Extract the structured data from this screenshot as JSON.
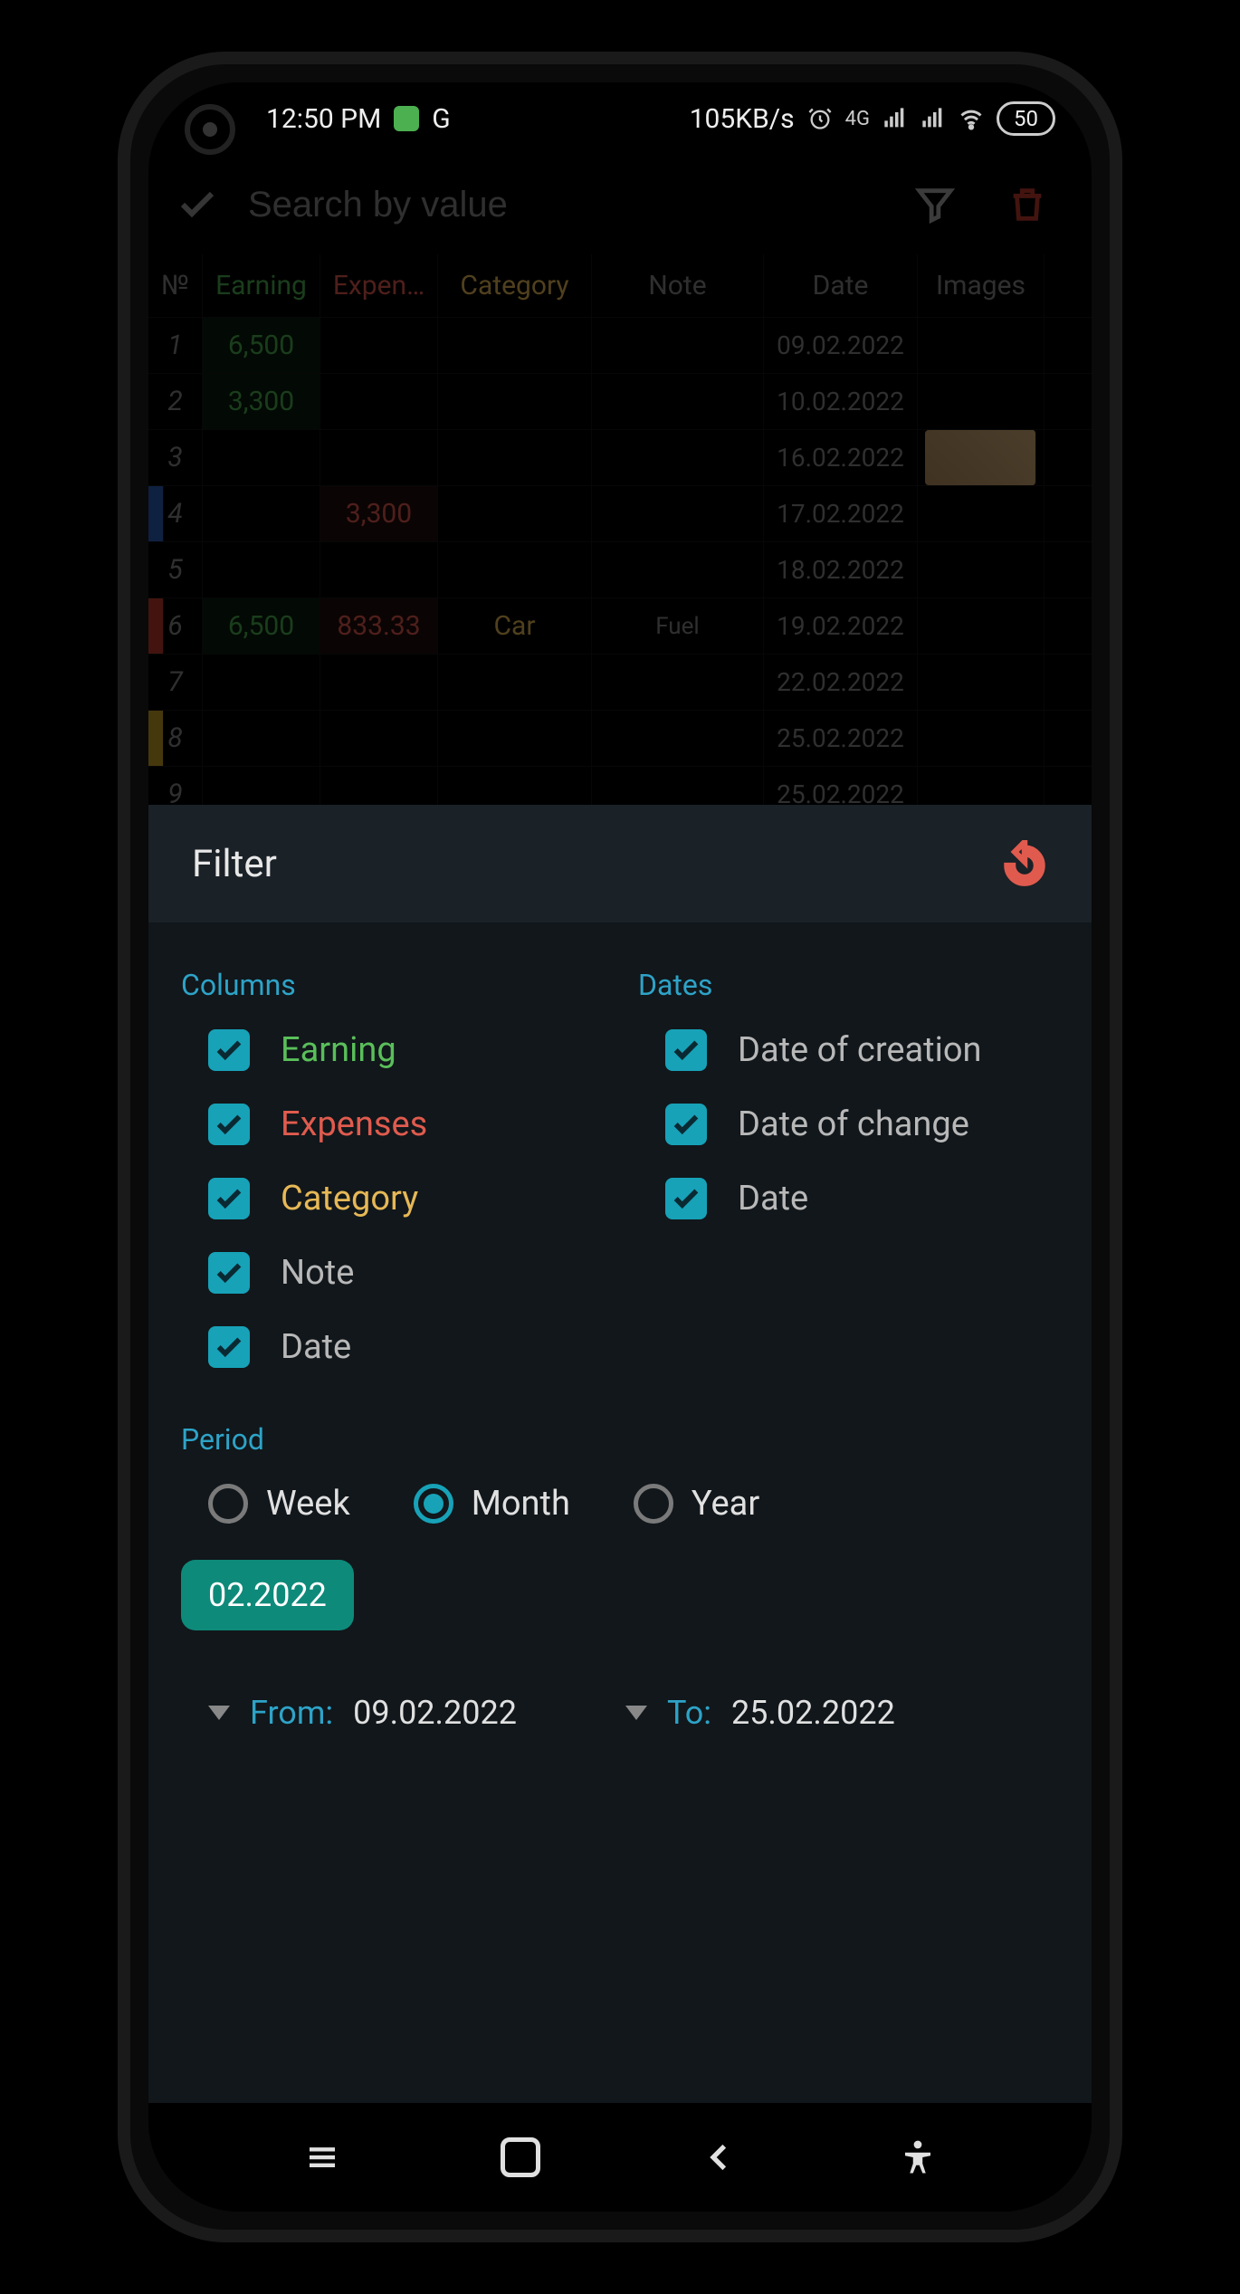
{
  "status": {
    "time": "12:50 PM",
    "speed": "105KB/s",
    "network": "4G",
    "battery": "50",
    "g_badge": "G"
  },
  "toolbar": {
    "search_placeholder": "Search by value"
  },
  "table": {
    "headers": {
      "num": "№",
      "earning": "Earning",
      "expense": "Expen…",
      "category": "Category",
      "note": "Note",
      "date": "Date",
      "images": "Images"
    },
    "rows": [
      {
        "n": "1",
        "earning": "6,500",
        "expense": "",
        "category": "",
        "note": "",
        "date": "09.02.2022",
        "stripe": "",
        "earn_bg": true,
        "exp_bg": false,
        "img": false
      },
      {
        "n": "2",
        "earning": "3,300",
        "expense": "",
        "category": "",
        "note": "",
        "date": "10.02.2022",
        "stripe": "",
        "earn_bg": true,
        "exp_bg": false,
        "img": false
      },
      {
        "n": "3",
        "earning": "",
        "expense": "",
        "category": "",
        "note": "",
        "date": "16.02.2022",
        "stripe": "",
        "earn_bg": false,
        "exp_bg": false,
        "img": true
      },
      {
        "n": "4",
        "earning": "",
        "expense": "3,300",
        "category": "",
        "note": "",
        "date": "17.02.2022",
        "stripe": "blue",
        "earn_bg": false,
        "exp_bg": true,
        "img": false
      },
      {
        "n": "5",
        "earning": "",
        "expense": "",
        "category": "",
        "note": "",
        "date": "18.02.2022",
        "stripe": "",
        "earn_bg": false,
        "exp_bg": false,
        "img": false
      },
      {
        "n": "6",
        "earning": "6,500",
        "expense": "833.33",
        "category": "Car",
        "note": "Fuel",
        "date": "19.02.2022",
        "stripe": "red",
        "earn_bg": true,
        "exp_bg": true,
        "img": false
      },
      {
        "n": "7",
        "earning": "",
        "expense": "",
        "category": "",
        "note": "",
        "date": "22.02.2022",
        "stripe": "",
        "earn_bg": false,
        "exp_bg": false,
        "img": false
      },
      {
        "n": "8",
        "earning": "",
        "expense": "",
        "category": "",
        "note": "",
        "date": "25.02.2022",
        "stripe": "yellow",
        "earn_bg": false,
        "exp_bg": false,
        "img": false
      },
      {
        "n": "9",
        "earning": "",
        "expense": "",
        "category": "",
        "note": "",
        "date": "25.02.2022",
        "stripe": "",
        "earn_bg": false,
        "exp_bg": false,
        "img": false
      }
    ]
  },
  "filter": {
    "title": "Filter",
    "columns_label": "Columns",
    "dates_label": "Dates",
    "columns": [
      {
        "label": "Earning",
        "cls": "lbl-earning"
      },
      {
        "label": "Expenses",
        "cls": "lbl-expense"
      },
      {
        "label": "Category",
        "cls": "lbl-category"
      },
      {
        "label": "Note",
        "cls": "lbl-dim"
      },
      {
        "label": "Date",
        "cls": "lbl-dim"
      }
    ],
    "dates": [
      {
        "label": "Date of creation"
      },
      {
        "label": "Date of change"
      },
      {
        "label": "Date"
      }
    ],
    "period_label": "Period",
    "period_options": [
      {
        "label": "Week",
        "selected": false
      },
      {
        "label": "Month",
        "selected": true
      },
      {
        "label": "Year",
        "selected": false
      }
    ],
    "period_chip": "02.2022",
    "from_label": "From:",
    "from_value": "09.02.2022",
    "to_label": "To:",
    "to_value": "25.02.2022"
  }
}
